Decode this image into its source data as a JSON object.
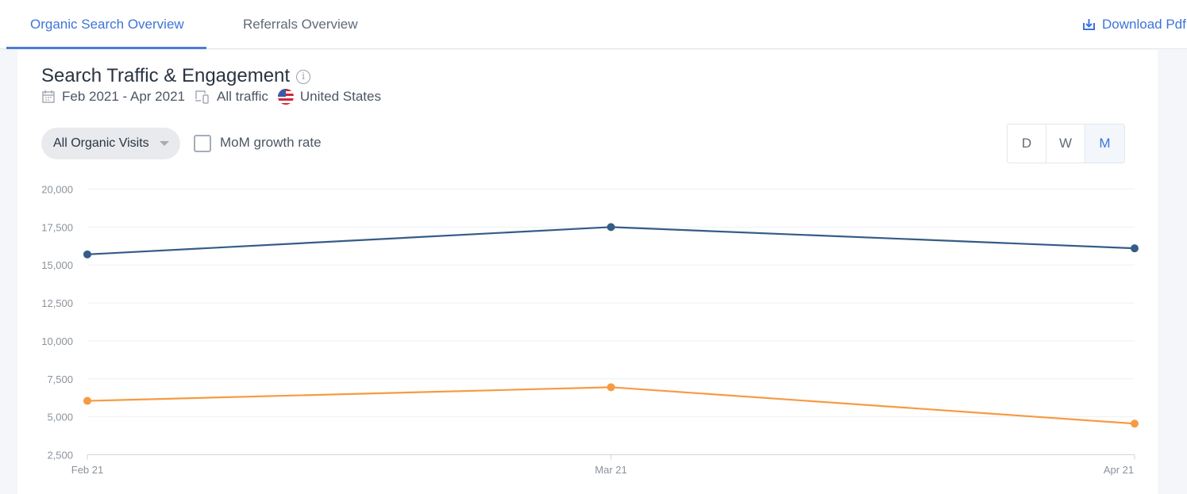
{
  "tabs": [
    {
      "label": "Organic Search Overview",
      "active": true
    },
    {
      "label": "Referrals Overview",
      "active": false
    }
  ],
  "download": {
    "label": "Download Pdf",
    "icon": "download-icon"
  },
  "card": {
    "title": "Search Traffic & Engagement",
    "info_icon": "i",
    "date_range": "Feb 2021 - Apr 2021",
    "traffic": "All traffic",
    "country": "United States",
    "dropdown_label": "All Organic Visits",
    "checkbox_label": "MoM growth rate",
    "checkbox_checked": false,
    "granularity": [
      {
        "label": "D"
      },
      {
        "label": "W"
      },
      {
        "label": "M",
        "selected": true
      }
    ]
  },
  "chart_data": {
    "type": "line",
    "categories": [
      "Feb 21",
      "Mar 21",
      "Apr 21"
    ],
    "ylim": [
      2500,
      20000
    ],
    "yticks": [
      "2,500",
      "5,000",
      "7,500",
      "10,000",
      "12,500",
      "15,000",
      "17,500",
      "20,000"
    ],
    "ytick_values": [
      2500,
      5000,
      7500,
      10000,
      12500,
      15000,
      17500,
      20000
    ],
    "grid": true,
    "series": [
      {
        "values": [
          15700,
          17500,
          16100
        ],
        "color": "#355c86"
      },
      {
        "values": [
          6050,
          6950,
          4550
        ],
        "color": "#f79a42"
      }
    ]
  }
}
